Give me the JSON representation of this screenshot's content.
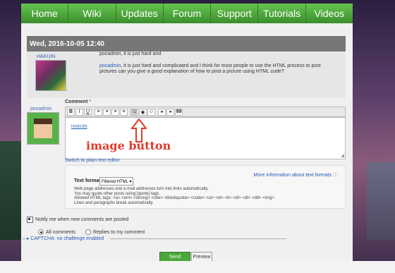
{
  "nav": {
    "items": [
      "Home",
      "Wiki",
      "Updates",
      "Forum",
      "Support",
      "Tutorials",
      "Videos"
    ]
  },
  "post": {
    "date_header": "Wed, 2016-10-05 12:40",
    "author": "HAKUIN",
    "line1": "pocadmin, it is just hard and",
    "line2_link": "pocadmin",
    "line2_rest": ", it is just hard and complicated and I think for most people to use the HTML process to post pictures can you give a good explanation of how to post a picture using HTML code?"
  },
  "reply": {
    "user": "pocadmin",
    "comment_label": "Comment",
    "required_mark": "*",
    "editor_content": "HAKUIN",
    "plain_link": "Switch to plain text editor"
  },
  "toolbar": [
    "B",
    "I",
    "U",
    "≡",
    "≡",
    "≡",
    "≡",
    "🖼",
    "◉",
    "☺",
    "⚭",
    "⚭",
    "99"
  ],
  "format": {
    "label": "Text format",
    "selected": "Filtered HTML ▾",
    "more_info": "More information about text formats",
    "tips": [
      "Web page addresses and e-mail addresses turn into links automatically.",
      "You may quote other posts using [quote] tags.",
      "Allowed HTML tags: <a> <em> <strong> <cite> <blockquote> <code> <ul> <ol> <li> <dl> <dt> <dd> <img>",
      "Lines and paragraphs break automatically."
    ]
  },
  "notify": {
    "label": "Notify me when new comments are posted",
    "all": "All comments",
    "replies": "Replies to my comment"
  },
  "captcha": "CAPTCHA: no challenge enabled",
  "buttons": {
    "send": "Send",
    "preview": "Preview"
  },
  "annotation": "image button",
  "colors": {
    "nav": "#3f9a2f",
    "annotation": "#e03a2b",
    "send": "#4aa83a"
  }
}
